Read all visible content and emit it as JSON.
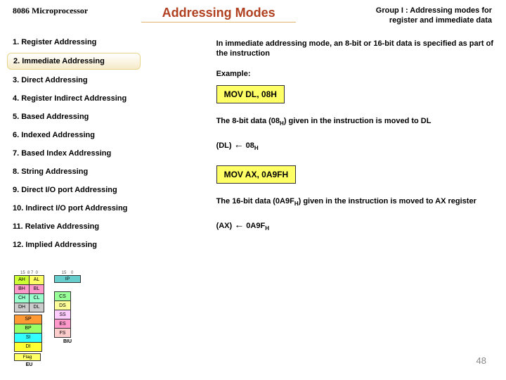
{
  "header": {
    "micro": "8086 Microprocessor",
    "title": "Addressing Modes",
    "group_line1": "Group I : Addressing modes for",
    "group_line2": "register and immediate data"
  },
  "modes": [
    "1.  Register Addressing",
    "2.  Immediate Addressing",
    "3.  Direct Addressing",
    "4.  Register Indirect Addressing",
    "5.  Based Addressing",
    "6.  Indexed Addressing",
    "7.  Based Index Addressing",
    "8.  String Addressing",
    "9.  Direct I/O port Addressing",
    "10. Indirect I/O port Addressing",
    "11. Relative Addressing",
    "12. Implied Addressing"
  ],
  "highlight_index": 1,
  "body": {
    "intro": "In immediate addressing mode, an 8-bit or 16-bit data is specified as part of the instruction",
    "example_label": "Example:",
    "ex1_code": "MOV DL, 08H",
    "ex1_desc_pre": "The 8-bit data (08",
    "ex1_desc_sub": "H",
    "ex1_desc_post": ") given in the instruction is moved to DL",
    "ex1_reg": "(DL) ",
    "ex1_val": " 08",
    "ex1_val_sub": "H",
    "ex2_code": "MOV AX, 0A9FH",
    "ex2_desc_pre": "The 16-bit data (0A9F",
    "ex2_desc_sub": "H",
    "ex2_desc_post": ") given in the instruction is moved to AX register",
    "ex2_reg": "(AX) ",
    "ex2_val": " 0A9F",
    "ex2_val_sub": "H"
  },
  "diagram": {
    "top8": [
      "8",
      "7",
      "0"
    ],
    "r8": [
      [
        "AH",
        "AL"
      ],
      [
        "BH",
        "BL"
      ],
      [
        "CH",
        "CL"
      ],
      [
        "DH",
        "DL"
      ]
    ],
    "r16_top": "15       0",
    "idx": [
      "SP",
      "BP",
      "SI",
      "DI"
    ],
    "seg": [
      "CS",
      "DS",
      "SS",
      "ES",
      "FS"
    ],
    "ip": "IP",
    "flag": "Flag register",
    "eu": "EU",
    "biu": "BIU"
  },
  "page": "48"
}
